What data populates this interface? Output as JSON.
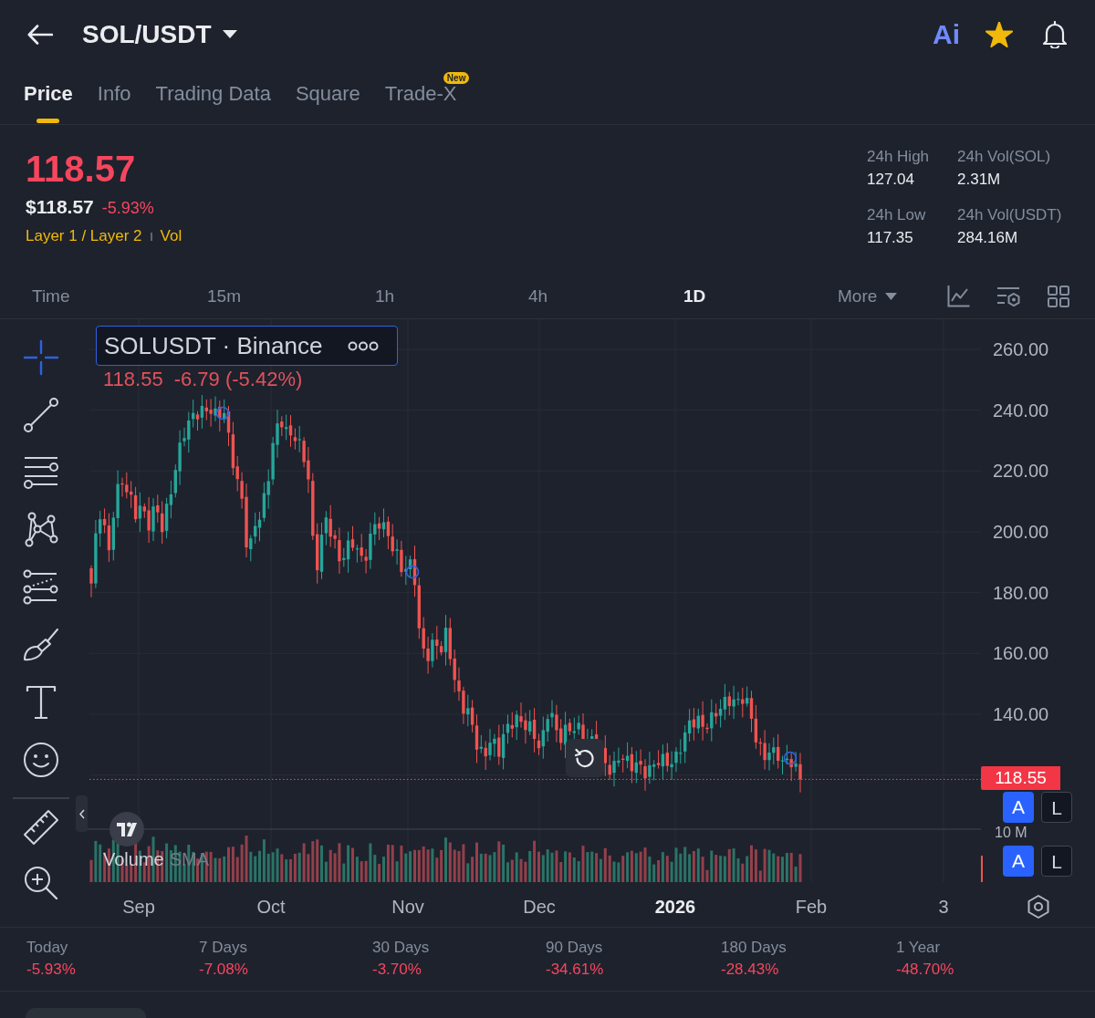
{
  "header": {
    "title": "SOL/USDT",
    "ai_label": "Ai",
    "favorite": true
  },
  "tabs": [
    {
      "label": "Price",
      "selected": true
    },
    {
      "label": "Info",
      "selected": false
    },
    {
      "label": "Trading Data",
      "selected": false
    },
    {
      "label": "Square",
      "selected": false
    },
    {
      "label": "Trade-X",
      "selected": false,
      "badge": "New"
    }
  ],
  "price": {
    "last": "118.57",
    "usd_price": "$118.57",
    "change": "-5.93%",
    "tags": [
      "Layer 1 / Layer 2",
      "Vol"
    ]
  },
  "stats": [
    {
      "label": "24h High",
      "value": "127.04"
    },
    {
      "label": "24h Vol(SOL)",
      "value": "2.31M"
    },
    {
      "label": "24h Low",
      "value": "117.35"
    },
    {
      "label": "24h Vol(USDT)",
      "value": "284.16M"
    }
  ],
  "intervals": [
    {
      "label": "Time",
      "kind": "option",
      "selected": false
    },
    {
      "label": "15m",
      "kind": "option",
      "selected": false
    },
    {
      "label": "1h",
      "kind": "option",
      "selected": false
    },
    {
      "label": "4h",
      "kind": "option",
      "selected": false
    },
    {
      "label": "1D",
      "kind": "option",
      "selected": true
    },
    {
      "label": "More",
      "kind": "dropdown",
      "selected": false
    }
  ],
  "tool_groups": [
    [
      {
        "kind": "crosshair",
        "selected": true
      },
      {
        "kind": "trend_line",
        "selected": false
      },
      {
        "kind": "fib_lines",
        "selected": false
      },
      {
        "kind": "pattern",
        "selected": false
      },
      {
        "kind": "forecast",
        "selected": false
      },
      {
        "kind": "brush",
        "selected": false
      },
      {
        "kind": "text",
        "selected": false
      },
      {
        "kind": "emoji",
        "selected": false
      }
    ],
    [
      {
        "kind": "ruler",
        "selected": false
      },
      {
        "kind": "zoom",
        "selected": false
      }
    ]
  ],
  "chart": {
    "symbol": "SOLUSDT · Binance",
    "last": "118.55",
    "change": "-6.79 (-5.42%)",
    "price_labels": [
      "260.00",
      "240.00",
      "220.00",
      "200.00",
      "180.00",
      "160.00",
      "140.00"
    ],
    "last_price_tag": "118.55",
    "volume_axis_label": "10 M",
    "volume_indicator": "Volume",
    "volume_average": "SMA",
    "time_labels": [
      {
        "label": "Sep",
        "kind": "month"
      },
      {
        "label": "Oct",
        "kind": "month"
      },
      {
        "label": "Nov",
        "kind": "month"
      },
      {
        "label": "Dec",
        "kind": "month"
      },
      {
        "label": "2026",
        "kind": "year"
      },
      {
        "label": "Feb",
        "kind": "month"
      },
      {
        "label": "3",
        "kind": "day"
      }
    ],
    "scale_buttons": [
      [
        {
          "label": "A",
          "selected": true
        },
        {
          "label": "L",
          "selected": false
        }
      ],
      [
        {
          "label": "A",
          "selected": true
        },
        {
          "label": "L",
          "selected": false
        }
      ]
    ]
  },
  "performance": [
    {
      "label": "Today",
      "value": "-5.93%"
    },
    {
      "label": "7 Days",
      "value": "-7.08%"
    },
    {
      "label": "30 Days",
      "value": "-3.70%"
    },
    {
      "label": "90 Days",
      "value": "-34.61%"
    },
    {
      "label": "180 Days",
      "value": "-28.43%"
    },
    {
      "label": "1 Year",
      "value": "-48.70%"
    }
  ]
}
